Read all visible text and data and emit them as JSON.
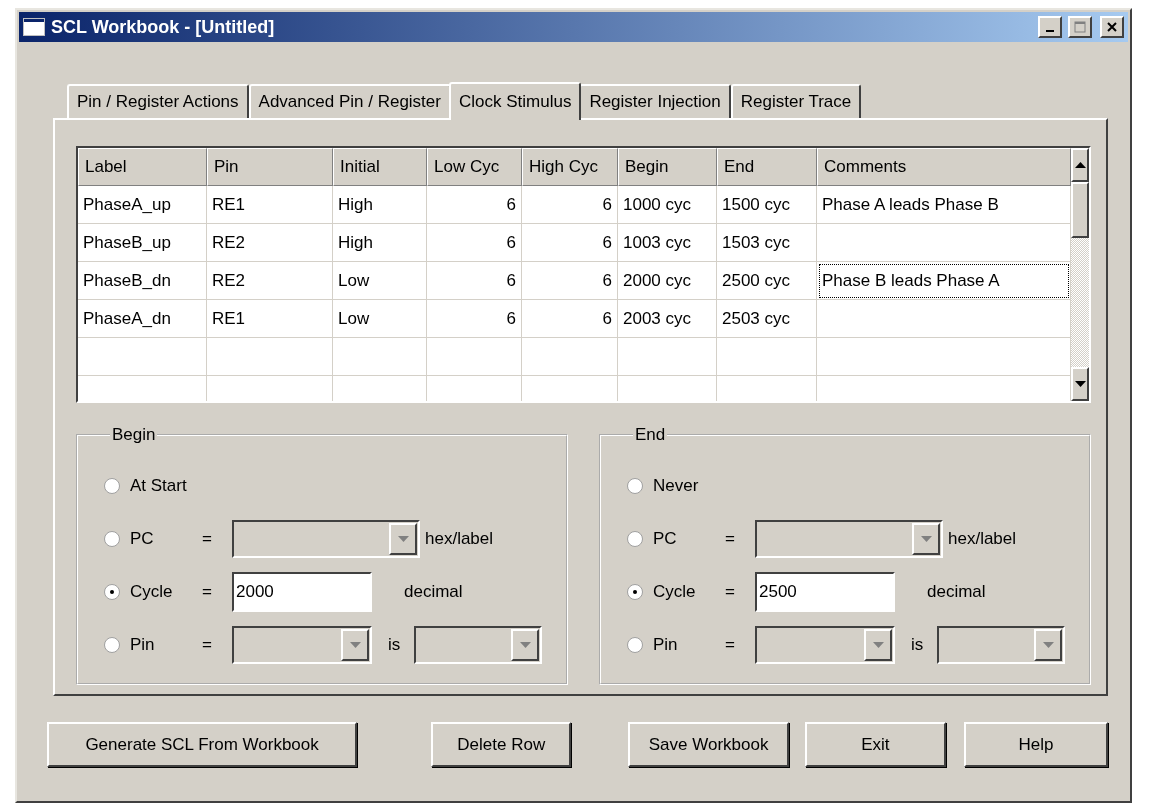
{
  "window": {
    "title": "SCL Workbook - [Untitled]"
  },
  "tabs": [
    {
      "label": "Pin / Register Actions",
      "selected": false
    },
    {
      "label": "Advanced Pin / Register",
      "selected": false
    },
    {
      "label": "Clock Stimulus",
      "selected": true
    },
    {
      "label": "Register Injection",
      "selected": false
    },
    {
      "label": "Register Trace",
      "selected": false
    }
  ],
  "table": {
    "columns": [
      "Label",
      "Pin",
      "Initial",
      "Low Cyc",
      "High Cyc",
      "Begin",
      "End",
      "Comments"
    ],
    "rows": [
      {
        "label": "PhaseA_up",
        "pin": "RE1",
        "initial": "High",
        "low_cyc": "6",
        "high_cyc": "6",
        "begin": "1000 cyc",
        "end": "1500 cyc",
        "comments": "Phase A leads Phase B",
        "focused": false
      },
      {
        "label": "PhaseB_up",
        "pin": "RE2",
        "initial": "High",
        "low_cyc": "6",
        "high_cyc": "6",
        "begin": "1003 cyc",
        "end": "1503 cyc",
        "focused": false
      },
      {
        "label": "PhaseB_dn",
        "pin": "RE2",
        "initial": "Low",
        "low_cyc": "6",
        "high_cyc": "6",
        "begin": "2000 cyc",
        "end": "2500 cyc",
        "comments": "Phase B leads Phase A",
        "focused": true
      },
      {
        "label": "PhaseA_dn",
        "pin": "RE1",
        "initial": "Low",
        "low_cyc": "6",
        "high_cyc": "6",
        "begin": "2003 cyc",
        "end": "2503 cyc",
        "focused": false
      }
    ]
  },
  "groups": [
    {
      "title": "Begin",
      "options": [
        {
          "kind": "plain",
          "label": "At Start",
          "selected": false
        },
        {
          "kind": "combo",
          "label": "PC",
          "equals": "=",
          "suffix": "hex/label",
          "disabled": true,
          "selected": false
        },
        {
          "kind": "input",
          "label": "Cycle",
          "equals": "=",
          "value": "2000",
          "suffix": "decimal",
          "selected": true
        },
        {
          "kind": "pin",
          "label": "Pin",
          "equals": "=",
          "connector": "is",
          "disabled": true,
          "selected": false
        }
      ]
    },
    {
      "title": "End",
      "options": [
        {
          "kind": "plain",
          "label": "Never",
          "selected": false
        },
        {
          "kind": "combo",
          "label": "PC",
          "equals": "=",
          "suffix": "hex/label",
          "disabled": true,
          "selected": false
        },
        {
          "kind": "input",
          "label": "Cycle",
          "equals": "=",
          "value": "2500",
          "suffix": "decimal",
          "selected": true
        },
        {
          "kind": "pin",
          "label": "Pin",
          "equals": "=",
          "connector": "is",
          "disabled": true,
          "selected": false
        }
      ]
    }
  ],
  "buttons": [
    "Generate SCL From Workbook",
    "Delete Row",
    "Save Workbook",
    "Exit",
    "Help"
  ]
}
